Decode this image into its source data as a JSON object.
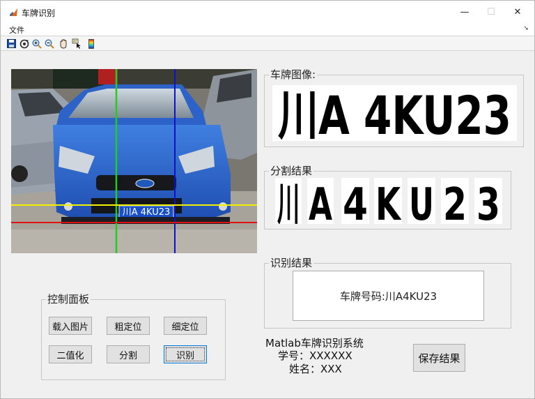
{
  "window": {
    "title": "车牌识别",
    "controls": {
      "minimize": "—",
      "maximize": "☐",
      "close": "✕"
    }
  },
  "menubar": {
    "items": [
      {
        "label": "文件"
      }
    ],
    "overflow_arrow": "➘"
  },
  "toolbar": {
    "icons": [
      "save-icon",
      "rotate-3d-icon",
      "zoom-in-icon",
      "zoom-out-icon",
      "pan-hand-icon",
      "data-cursor-icon",
      "colorbar-icon"
    ]
  },
  "car_image": {
    "plate_text": "川A 4KU23",
    "lines": {
      "vertical_colors": [
        "#22cc22",
        "#1010c8"
      ],
      "horizontal_colors": [
        "#f2f200",
        "#e01010"
      ]
    }
  },
  "plate_panel": {
    "title": "车牌图像:",
    "plate_text": "川A 4KU23"
  },
  "segmentation_panel": {
    "title": "分割结果",
    "chars": [
      "川",
      "A",
      "4",
      "K",
      "U",
      "2",
      "3"
    ]
  },
  "recognition_panel": {
    "title": "识别结果",
    "result": "车牌号码:川A4KU23"
  },
  "control_panel": {
    "title": "控制面板",
    "buttons": {
      "load": "载入图片",
      "coarse": "粗定位",
      "fine": "细定位",
      "binarize": "二值化",
      "segment": "分割",
      "recognize": "识别"
    }
  },
  "info": {
    "system_name": "Matlab车牌识别系统",
    "student_id": "学号：XXXXXX",
    "name": "姓名：XXX"
  },
  "save_button": {
    "label": "保存结果"
  }
}
